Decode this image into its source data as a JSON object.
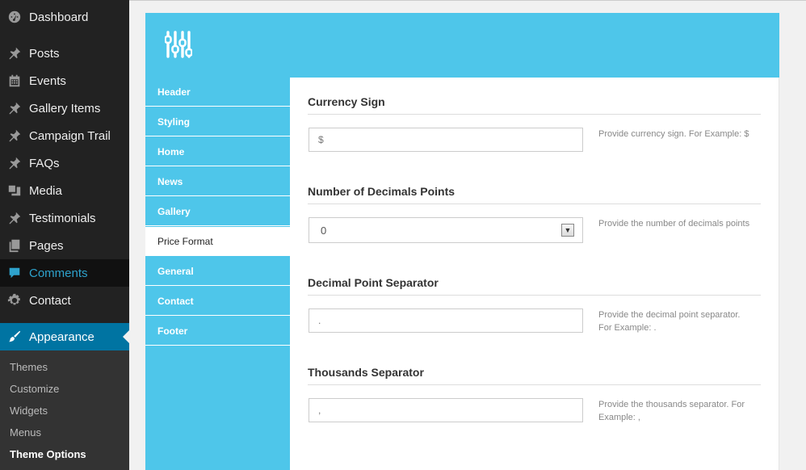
{
  "sidebar": {
    "items": [
      {
        "label": "Dashboard",
        "icon": "dashboard-icon"
      },
      {
        "label": "Posts",
        "icon": "pin-icon"
      },
      {
        "label": "Events",
        "icon": "calendar-icon"
      },
      {
        "label": "Gallery Items",
        "icon": "pin-icon"
      },
      {
        "label": "Campaign Trail",
        "icon": "pin-icon"
      },
      {
        "label": "FAQs",
        "icon": "pin-icon"
      },
      {
        "label": "Media",
        "icon": "media-icon"
      },
      {
        "label": "Testimonials",
        "icon": "pin-icon"
      },
      {
        "label": "Pages",
        "icon": "pages-icon"
      },
      {
        "label": "Comments",
        "icon": "comment-icon"
      },
      {
        "label": "Contact",
        "icon": "gear-icon"
      },
      {
        "label": "Appearance",
        "icon": "brush-icon"
      }
    ],
    "submenu": [
      "Themes",
      "Customize",
      "Widgets",
      "Menus",
      "Theme Options"
    ]
  },
  "theme_options": {
    "header_icon": "sliders-icon",
    "tabs": [
      "Header",
      "Styling",
      "Home",
      "News",
      "Gallery",
      "Price Format",
      "General",
      "Contact",
      "Footer"
    ],
    "active_tab": "Price Format",
    "fields": {
      "currency_sign": {
        "title": "Currency Sign",
        "value": "$",
        "desc": "Provide currency sign. For Example: $"
      },
      "decimals": {
        "title": "Number of Decimals Points",
        "value": "0",
        "desc": "Provide the number of decimals points"
      },
      "decimal_separator": {
        "title": "Decimal Point Separator",
        "value": ".",
        "desc_line1": "Provide the decimal point separator.",
        "desc_line2": "For Example: ."
      },
      "thousands_separator": {
        "title": "Thousands Separator",
        "value": ",",
        "desc_line1": "Provide the thousands separator. For",
        "desc_line2": "Example: ,"
      }
    }
  },
  "colors": {
    "accent": "#4ec6ea",
    "sidebar_bg": "#222222",
    "active_menu": "#0074a2",
    "comments_highlight": "#2ea2cc"
  }
}
